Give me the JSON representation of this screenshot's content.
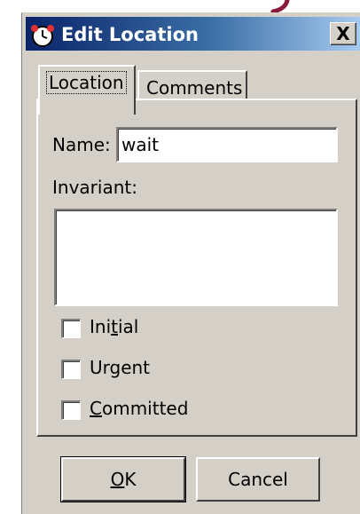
{
  "window": {
    "title": "Edit Location",
    "close_label": "X"
  },
  "tabs": [
    {
      "label": "Location",
      "active": true
    },
    {
      "label": "Comments",
      "active": false
    }
  ],
  "form": {
    "name_label": "Name:",
    "name_value": "wait",
    "invariant_label": "Invariant:",
    "invariant_value": ""
  },
  "checkboxes": [
    {
      "label_pre": "Ini",
      "label_mnemonic": "t",
      "label_post": "ial",
      "checked": false
    },
    {
      "label_pre": "Urgent",
      "label_mnemonic": "",
      "label_post": "",
      "checked": false
    },
    {
      "label_pre": "",
      "label_mnemonic": "C",
      "label_post": "ommitted",
      "checked": false
    }
  ],
  "buttons": {
    "ok_mnemonic": "O",
    "ok_rest": "K",
    "cancel_label": "Cancel"
  },
  "colors": {
    "dialog_face": "#d4d0c8",
    "title_gradient_start": "#0a246a",
    "title_gradient_end": "#a6caf0",
    "decorative_arc": "#8b1a3a"
  },
  "icons": {
    "title": "location-clock-icon"
  }
}
